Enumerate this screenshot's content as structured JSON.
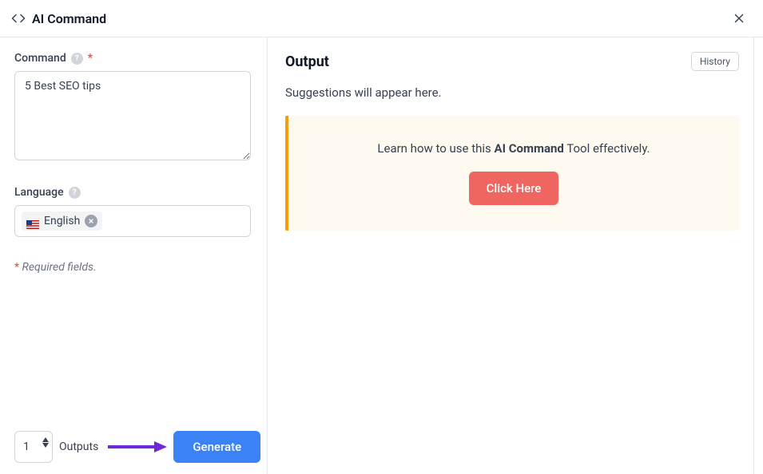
{
  "header": {
    "title": "AI Command"
  },
  "sidebar": {
    "command": {
      "label": "Command",
      "value": "5 Best SEO tips",
      "required_marker": "*"
    },
    "language": {
      "label": "Language",
      "chip_value": "English"
    },
    "required_note_marker": "*",
    "required_note_text": " Required fields.",
    "footer": {
      "outputs_value": "1",
      "outputs_label": "Outputs",
      "generate_label": "Generate"
    }
  },
  "output": {
    "title": "Output",
    "history_label": "History",
    "placeholder": "Suggestions will appear here.",
    "info": {
      "prefix": "Learn how to use this ",
      "bold": "AI Command",
      "suffix": " Tool effectively.",
      "button": "Click Here"
    }
  }
}
